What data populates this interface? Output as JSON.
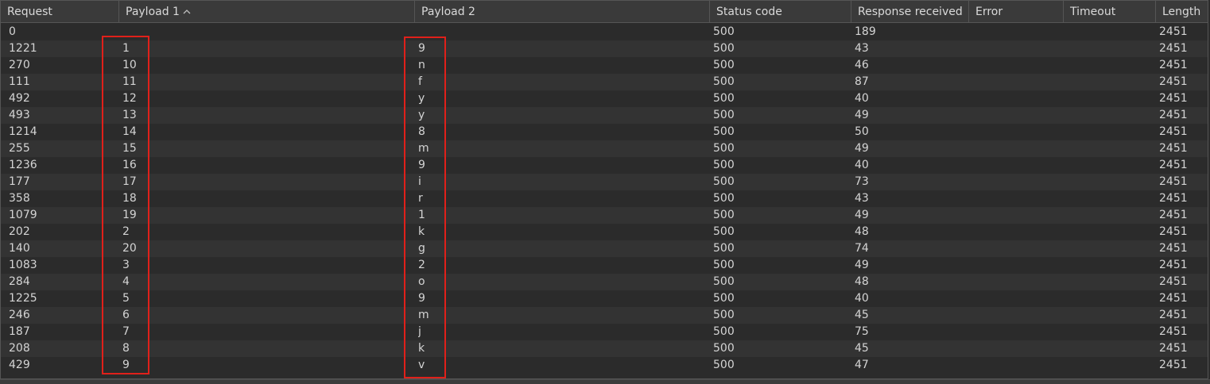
{
  "table": {
    "columns": [
      {
        "key": "request",
        "label": "Request"
      },
      {
        "key": "payload1",
        "label": "Payload 1",
        "sort": "ascending"
      },
      {
        "key": "payload2",
        "label": "Payload 2"
      },
      {
        "key": "status",
        "label": "Status code"
      },
      {
        "key": "response",
        "label": "Response received"
      },
      {
        "key": "error",
        "label": "Error"
      },
      {
        "key": "timeout",
        "label": "Timeout"
      },
      {
        "key": "length",
        "label": "Length"
      }
    ],
    "sort_arrow_icon": "chevron-up-icon",
    "rows": [
      {
        "request": "0",
        "payload1": "",
        "payload2": "",
        "status": "500",
        "response": "189",
        "error": "",
        "timeout": "",
        "length": "2451"
      },
      {
        "request": "1221",
        "payload1": "1",
        "payload2": "9",
        "status": "500",
        "response": "43",
        "error": "",
        "timeout": "",
        "length": "2451"
      },
      {
        "request": "270",
        "payload1": "10",
        "payload2": "n",
        "status": "500",
        "response": "46",
        "error": "",
        "timeout": "",
        "length": "2451"
      },
      {
        "request": "111",
        "payload1": "11",
        "payload2": "f",
        "status": "500",
        "response": "87",
        "error": "",
        "timeout": "",
        "length": "2451"
      },
      {
        "request": "492",
        "payload1": "12",
        "payload2": "y",
        "status": "500",
        "response": "40",
        "error": "",
        "timeout": "",
        "length": "2451"
      },
      {
        "request": "493",
        "payload1": "13",
        "payload2": "y",
        "status": "500",
        "response": "49",
        "error": "",
        "timeout": "",
        "length": "2451"
      },
      {
        "request": "1214",
        "payload1": "14",
        "payload2": "8",
        "status": "500",
        "response": "50",
        "error": "",
        "timeout": "",
        "length": "2451"
      },
      {
        "request": "255",
        "payload1": "15",
        "payload2": "m",
        "status": "500",
        "response": "49",
        "error": "",
        "timeout": "",
        "length": "2451"
      },
      {
        "request": "1236",
        "payload1": "16",
        "payload2": "9",
        "status": "500",
        "response": "40",
        "error": "",
        "timeout": "",
        "length": "2451"
      },
      {
        "request": "177",
        "payload1": "17",
        "payload2": "i",
        "status": "500",
        "response": "73",
        "error": "",
        "timeout": "",
        "length": "2451"
      },
      {
        "request": "358",
        "payload1": "18",
        "payload2": "r",
        "status": "500",
        "response": "43",
        "error": "",
        "timeout": "",
        "length": "2451"
      },
      {
        "request": "1079",
        "payload1": "19",
        "payload2": "1",
        "status": "500",
        "response": "49",
        "error": "",
        "timeout": "",
        "length": "2451"
      },
      {
        "request": "202",
        "payload1": "2",
        "payload2": "k",
        "status": "500",
        "response": "48",
        "error": "",
        "timeout": "",
        "length": "2451"
      },
      {
        "request": "140",
        "payload1": "20",
        "payload2": "g",
        "status": "500",
        "response": "74",
        "error": "",
        "timeout": "",
        "length": "2451"
      },
      {
        "request": "1083",
        "payload1": "3",
        "payload2": "2",
        "status": "500",
        "response": "49",
        "error": "",
        "timeout": "",
        "length": "2451"
      },
      {
        "request": "284",
        "payload1": "4",
        "payload2": "o",
        "status": "500",
        "response": "48",
        "error": "",
        "timeout": "",
        "length": "2451"
      },
      {
        "request": "1225",
        "payload1": "5",
        "payload2": "9",
        "status": "500",
        "response": "40",
        "error": "",
        "timeout": "",
        "length": "2451"
      },
      {
        "request": "246",
        "payload1": "6",
        "payload2": "m",
        "status": "500",
        "response": "45",
        "error": "",
        "timeout": "",
        "length": "2451"
      },
      {
        "request": "187",
        "payload1": "7",
        "payload2": "j",
        "status": "500",
        "response": "75",
        "error": "",
        "timeout": "",
        "length": "2451"
      },
      {
        "request": "208",
        "payload1": "8",
        "payload2": "k",
        "status": "500",
        "response": "45",
        "error": "",
        "timeout": "",
        "length": "2451"
      },
      {
        "request": "429",
        "payload1": "9",
        "payload2": "v",
        "status": "500",
        "response": "47",
        "error": "",
        "timeout": "",
        "length": "2451"
      }
    ]
  },
  "annotations": {
    "highlight_color": "#e0201a",
    "highlighted_columns": [
      "payload1",
      "payload2"
    ]
  },
  "colors": {
    "background": "#2b2b2b",
    "row_alt": "#333333",
    "header_bg": "#3a3a3a",
    "text": "#d4d4d4"
  }
}
